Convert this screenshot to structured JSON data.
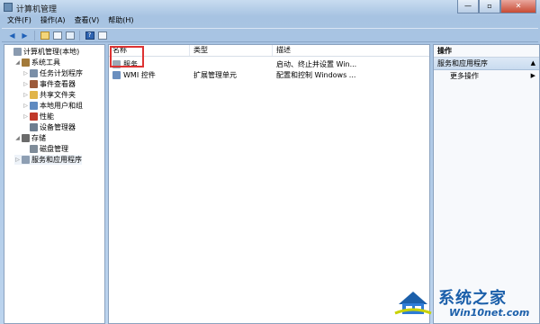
{
  "window": {
    "title": "计算机管理"
  },
  "menu": [
    {
      "label": "文件(F)"
    },
    {
      "label": "操作(A)"
    },
    {
      "label": "查看(V)"
    },
    {
      "label": "帮助(H)"
    }
  ],
  "toolbar": [
    {
      "icon": "back-arrow-icon"
    },
    {
      "icon": "forward-arrow-icon"
    },
    {
      "icon": "up-folder-icon"
    },
    {
      "icon": "show-hide-tree-icon"
    },
    {
      "icon": "export-icon"
    },
    {
      "icon": "help-icon"
    },
    {
      "icon": "properties-icon"
    }
  ],
  "tree": {
    "items": [
      {
        "label": "计算机管理(本地)",
        "indent": 0,
        "expander": "",
        "icon": "computer-management-icon",
        "color": "#8a9bb0"
      },
      {
        "label": "系统工具",
        "indent": 1,
        "expander": "◢",
        "icon": "system-tools-icon",
        "color": "#a37a3a"
      },
      {
        "label": "任务计划程序",
        "indent": 2,
        "expander": "▷",
        "icon": "task-scheduler-icon",
        "color": "#7a8fa8"
      },
      {
        "label": "事件查看器",
        "indent": 2,
        "expander": "▷",
        "icon": "event-viewer-icon",
        "color": "#9c5a3a"
      },
      {
        "label": "共享文件夹",
        "indent": 2,
        "expander": "▷",
        "icon": "shared-folder-icon",
        "color": "#e1b54a"
      },
      {
        "label": "本地用户和组",
        "indent": 2,
        "expander": "▷",
        "icon": "users-icon",
        "color": "#5f8ac0"
      },
      {
        "label": "性能",
        "indent": 2,
        "expander": "▷",
        "icon": "performance-icon",
        "color": "#c0392b"
      },
      {
        "label": "设备管理器",
        "indent": 2,
        "expander": "",
        "icon": "device-manager-icon",
        "color": "#6e7e90"
      },
      {
        "label": "存储",
        "indent": 1,
        "expander": "◢",
        "icon": "storage-icon",
        "color": "#6b6b6b"
      },
      {
        "label": "磁盘管理",
        "indent": 2,
        "expander": "",
        "icon": "disk-management-icon",
        "color": "#7f8c99"
      },
      {
        "label": "服务和应用程序",
        "indent": 1,
        "expander": "▷",
        "icon": "services-apps-icon",
        "color": "#8e9fb3",
        "selected": true
      }
    ]
  },
  "list": {
    "columns": [
      "名称",
      "类型",
      "描述"
    ],
    "rows": [
      {
        "name": "服务",
        "type": "",
        "desc": "启动、终止并设置 Win...",
        "icon": "services-icon",
        "color": "#9aa8b6"
      },
      {
        "name": "WMI 控件",
        "type": "扩展管理单元",
        "desc": "配置和控制 Windows ...",
        "icon": "wmi-control-icon",
        "color": "#6a8fbf"
      }
    ]
  },
  "actions": {
    "header": "操作",
    "section": "服务和应用程序",
    "items": [
      {
        "label": "更多操作"
      }
    ]
  },
  "watermark": {
    "title": "系统之家",
    "url": "Win10net.com"
  }
}
